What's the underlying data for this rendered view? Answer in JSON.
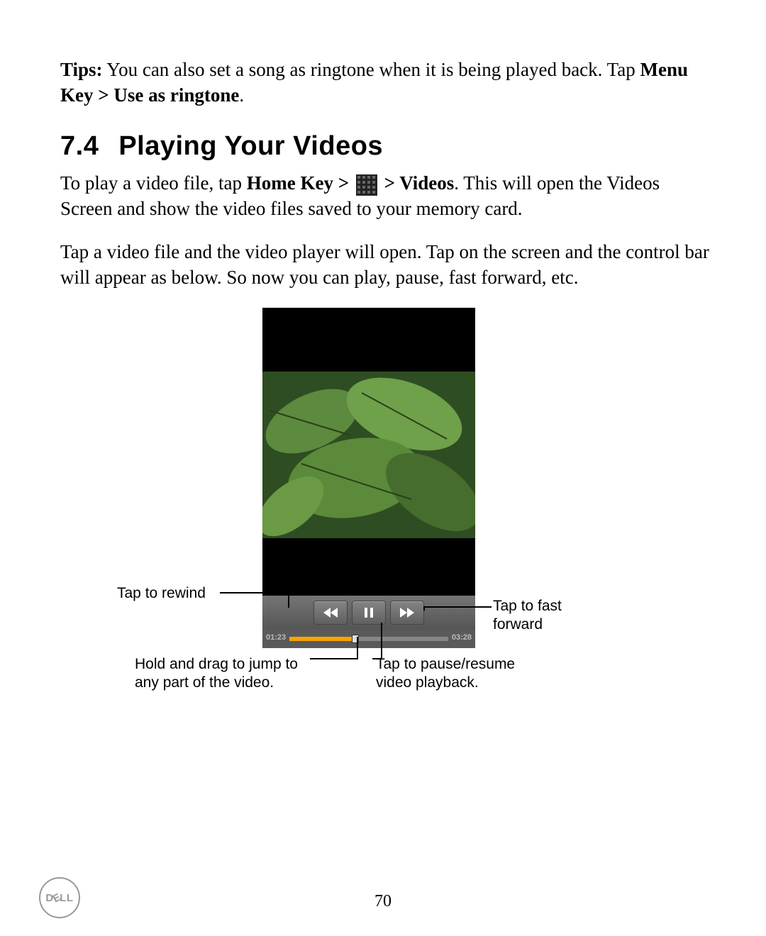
{
  "tips": {
    "label": "Tips:",
    "text_part1": " You can also set a song as ringtone when it is being played back. Tap ",
    "bold_path": "Menu Key > Use as ringtone",
    "text_part2": "."
  },
  "section": {
    "number": "7.4",
    "title": "Playing Your Videos"
  },
  "para1": {
    "t1": "To play a video file, tap ",
    "bold1": "Home Key > ",
    "bold2": " > Videos",
    "t2": ". This will open the Videos Screen and show the video files saved to your memory card."
  },
  "para2": "Tap a video file and the video player will open. Tap on the screen and the control bar will appear as below. So now you can play, pause, fast forward, etc.",
  "player": {
    "elapsed": "01:23",
    "total": "03:28",
    "progress_fraction": 0.41,
    "buttons": {
      "rewind": "rewind",
      "pause": "pause",
      "forward": "fast-forward"
    }
  },
  "callouts": {
    "rewind": "Tap to rewind",
    "ff": "Tap to fast forward",
    "drag": "Hold and drag to jump to any part of the video.",
    "pause": "Tap to pause/resume video playback."
  },
  "page_number": "70",
  "brand": "DELL"
}
